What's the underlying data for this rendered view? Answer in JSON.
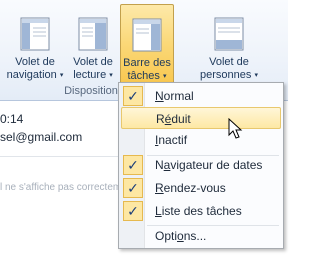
{
  "ribbon": {
    "buttons": [
      {
        "line1": "Volet de",
        "line2": "navigation",
        "caret": "▾"
      },
      {
        "line1": "Volet de",
        "line2": "lecture",
        "caret": "▾"
      },
      {
        "line1": "Barre des",
        "line2": "tâches",
        "caret": "▾"
      },
      {
        "line1": "Volet de",
        "line2": "personnes",
        "caret": "▾"
      }
    ],
    "group_label": "Disposition"
  },
  "background": {
    "time": "0:14",
    "email": "sel@gmail.com",
    "faint_text": "l ne s'affiche pas correctement"
  },
  "menu": {
    "items": [
      {
        "pre": "",
        "key": "N",
        "post": "ormal",
        "checked": true
      },
      {
        "pre": "R",
        "key": "é",
        "post": "duit",
        "checked": false
      },
      {
        "pre": "",
        "key": "I",
        "post": "nactif",
        "checked": false
      },
      {
        "pre": "N",
        "key": "a",
        "post": "vigateur de dates",
        "checked": true
      },
      {
        "pre": "",
        "key": "R",
        "post": "endez-vous",
        "checked": true
      },
      {
        "pre": "",
        "key": "L",
        "post": "iste des tâches",
        "checked": true
      },
      {
        "pre": "Opti",
        "key": "o",
        "post": "ns...",
        "checked": false
      }
    ],
    "checkmark": "✓"
  },
  "colors": {
    "active_button": "#f8c64d",
    "hover_item": "#fde8a4",
    "check_box": "#fde7a3"
  }
}
